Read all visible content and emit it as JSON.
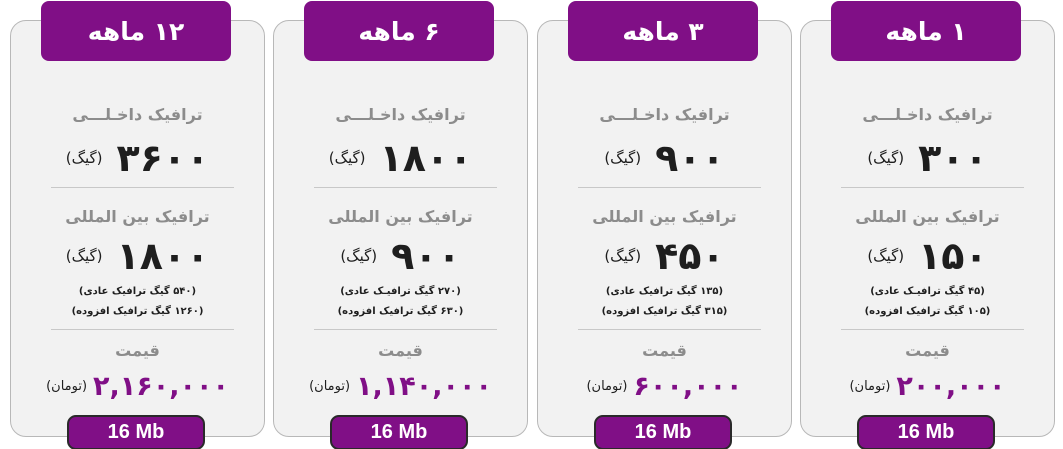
{
  "colors": {
    "accent": "#800f86",
    "card_bg": "#f2f2f2",
    "label_gray": "#8c8c8c"
  },
  "plans": [
    {
      "title": "۱۲ ماهه",
      "domestic_label": "ترافیک داخـلـــی",
      "domestic_value": "۳۶۰۰",
      "domestic_unit": "(گیگ)",
      "international_label": "ترافیک بین المللی",
      "international_value": "۱۸۰۰",
      "international_unit": "(گیگ)",
      "detail_normal": "(۵۴۰ گیگ ترافیک عادی)",
      "detail_added": "(۱۲۶۰ گیگ ترافیک افزوده)",
      "price_label": "قیمت",
      "price_value": "۲,۱۶۰,۰۰۰",
      "price_unit": "(تومان)",
      "speed": "16 Mb"
    },
    {
      "title": "۶ ماهه",
      "domestic_label": "ترافیک داخـلـــی",
      "domestic_value": "۱۸۰۰",
      "domestic_unit": "(گیگ)",
      "international_label": "ترافیک بین المللی",
      "international_value": "۹۰۰",
      "international_unit": "(گیگ)",
      "detail_normal": "(۲۷۰ گیگ ترافیـک عادی)",
      "detail_added": "(۶۳۰ گیگ ترافیک افزوده)",
      "price_label": "قیمت",
      "price_value": "۱,۱۴۰,۰۰۰",
      "price_unit": "(تومان)",
      "speed": "16 Mb"
    },
    {
      "title": "۳ ماهه",
      "domestic_label": "ترافیک داخـلـــی",
      "domestic_value": "۹۰۰",
      "domestic_unit": "(گیگ)",
      "international_label": "ترافیک بین المللی",
      "international_value": "۴۵۰",
      "international_unit": "(گیگ)",
      "detail_normal": "(۱۳۵ گیگ ترافیک عادی)",
      "detail_added": "(۳۱۵ گیگ ترافیک افزوده)",
      "price_label": "قیمت",
      "price_value": "۶۰۰,۰۰۰",
      "price_unit": "(تومان)",
      "speed": "16 Mb"
    },
    {
      "title": "۱ ماهه",
      "domestic_label": "ترافیک داخـلـــی",
      "domestic_value": "۳۰۰",
      "domestic_unit": "(گیگ)",
      "international_label": "ترافیک بین المللی",
      "international_value": "۱۵۰",
      "international_unit": "(گیگ)",
      "detail_normal": "(۴۵ گیگ ترافیـک عادی)",
      "detail_added": "(۱۰۵ گیگ ترافیک افزوده)",
      "price_label": "قیمت",
      "price_value": "۲۰۰,۰۰۰",
      "price_unit": "(تومان)",
      "speed": "16 Mb"
    }
  ]
}
